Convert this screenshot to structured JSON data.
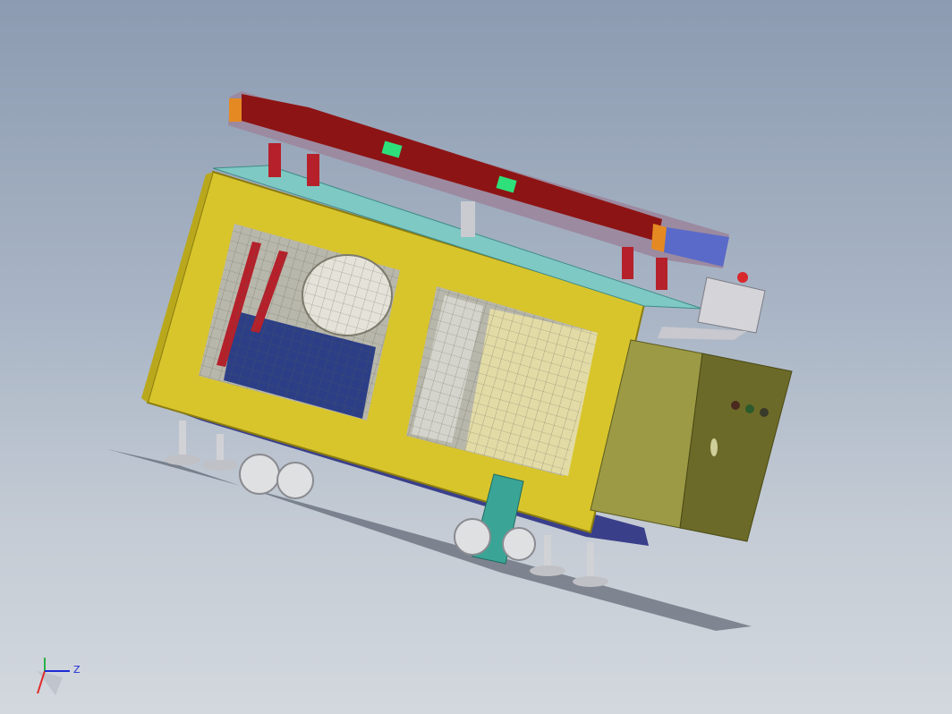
{
  "viewport": {
    "background_top": "#8c9bb1",
    "background_bottom": "#d3d8de"
  },
  "model": {
    "colors": {
      "frame": "#d8c52c",
      "frame_edge": "#8a7c10",
      "panel_top": "#7ec9c4",
      "top_beam": "#8d1414",
      "top_plate": "#9c8aa0",
      "indicator_green": "#2ee07a",
      "tank_blue": "#2c3f86",
      "cabinet": "#9c9a45",
      "cabinet_side": "#6c6a28",
      "bracket": "#3aa597",
      "wheel": "#dfe0e2",
      "base": "#3a3f8a"
    }
  },
  "triad": {
    "axes": [
      "x-axis-icon",
      "y-axis-icon",
      "z-axis-icon"
    ],
    "z_label": "Z"
  }
}
